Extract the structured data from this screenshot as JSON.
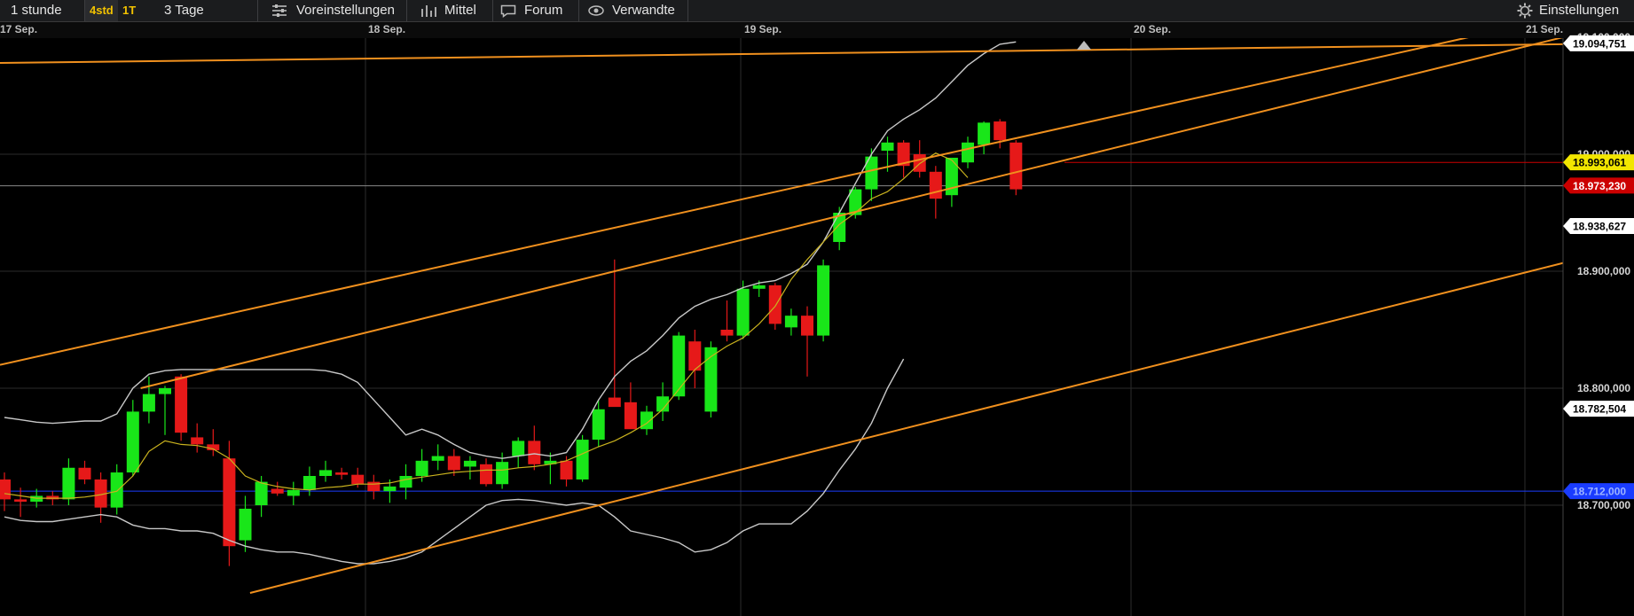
{
  "toolbar": {
    "interval_label": "1 stunde",
    "range_4std": "4std",
    "range_1t": "1T",
    "range_3tage": "3 Tage",
    "presets_label": "Voreinstellungen",
    "indicator_label": "Mittel",
    "forum_label": "Forum",
    "related_label": "Verwandte",
    "settings_label": "Einstellungen",
    "icons": {
      "presets": "sliders-icon",
      "indicator": "bar-chart-icon",
      "forum": "speech-bubble-icon",
      "related": "eye-icon",
      "settings": "gear-icon"
    }
  },
  "colors": {
    "up": "#19e619",
    "down": "#e61919",
    "channel": "#f0901e",
    "band": "#c8c8c8",
    "sma": "#c9b21e",
    "price_marker": "#cc0000",
    "ref_marker": "#f2e600",
    "blue_level": "#1a3cff",
    "background": "#000000"
  },
  "chart_data": {
    "type": "candlestick",
    "title": "",
    "xlabel": "",
    "ylabel": "",
    "ylim": [
      18.58,
      19.1
    ],
    "x_date_ticks": [
      "17 Sep.",
      "18 Sep.",
      "19 Sep.",
      "20 Sep.",
      "21 Sep."
    ],
    "y_tick_labels": [
      "19.100,000",
      "19.000,000",
      "18.900,000",
      "18.800,000",
      "18.700,000"
    ],
    "y_ticks": [
      19.1,
      19.0,
      18.9,
      18.8,
      18.7
    ],
    "series_candles": [
      [
        18.722,
        18.728,
        18.695,
        18.705
      ],
      [
        18.705,
        18.715,
        18.69,
        18.703
      ],
      [
        18.703,
        18.714,
        18.698,
        18.708
      ],
      [
        18.708,
        18.712,
        18.7,
        18.705
      ],
      [
        18.705,
        18.74,
        18.7,
        18.732
      ],
      [
        18.732,
        18.738,
        18.718,
        18.722
      ],
      [
        18.722,
        18.728,
        18.685,
        18.698
      ],
      [
        18.698,
        18.735,
        18.692,
        18.728
      ],
      [
        18.728,
        18.79,
        18.725,
        18.78
      ],
      [
        18.78,
        18.81,
        18.77,
        18.795
      ],
      [
        18.795,
        18.802,
        18.76,
        18.8
      ],
      [
        18.81,
        18.812,
        18.755,
        18.762
      ],
      [
        18.758,
        18.77,
        18.745,
        18.752
      ],
      [
        18.752,
        18.765,
        18.742,
        18.747
      ],
      [
        18.74,
        18.755,
        18.648,
        18.665
      ],
      [
        18.67,
        18.708,
        18.66,
        18.697
      ],
      [
        18.7,
        18.725,
        18.69,
        18.72
      ],
      [
        18.714,
        18.72,
        18.708,
        18.71
      ],
      [
        18.708,
        18.72,
        18.7,
        18.713
      ],
      [
        18.713,
        18.733,
        18.708,
        18.725
      ],
      [
        18.725,
        18.738,
        18.72,
        18.73
      ],
      [
        18.728,
        18.732,
        18.722,
        18.726
      ],
      [
        18.726,
        18.732,
        18.715,
        18.718
      ],
      [
        18.72,
        18.726,
        18.705,
        18.712
      ],
      [
        18.712,
        18.722,
        18.702,
        18.716
      ],
      [
        18.715,
        18.735,
        18.705,
        18.725
      ],
      [
        18.725,
        18.748,
        18.72,
        18.738
      ],
      [
        18.738,
        18.752,
        18.73,
        18.742
      ],
      [
        18.742,
        18.748,
        18.725,
        18.73
      ],
      [
        18.733,
        18.742,
        18.722,
        18.738
      ],
      [
        18.735,
        18.74,
        18.716,
        18.718
      ],
      [
        18.718,
        18.745,
        18.714,
        18.737
      ],
      [
        18.742,
        18.758,
        18.732,
        18.755
      ],
      [
        18.755,
        18.768,
        18.73,
        18.735
      ],
      [
        18.735,
        18.745,
        18.718,
        18.738
      ],
      [
        18.738,
        18.742,
        18.716,
        18.722
      ],
      [
        18.722,
        18.76,
        18.72,
        18.756
      ],
      [
        18.756,
        18.79,
        18.75,
        18.782
      ],
      [
        18.792,
        18.91,
        18.786,
        18.784
      ],
      [
        18.788,
        18.805,
        18.77,
        18.765
      ],
      [
        18.765,
        18.785,
        18.76,
        18.78
      ],
      [
        18.78,
        18.805,
        18.772,
        18.793
      ],
      [
        18.793,
        18.848,
        18.79,
        18.845
      ],
      [
        18.84,
        18.85,
        18.8,
        18.815
      ],
      [
        18.78,
        18.84,
        18.775,
        18.835
      ],
      [
        18.85,
        18.875,
        18.84,
        18.845
      ],
      [
        18.845,
        18.892,
        18.842,
        18.885
      ],
      [
        18.885,
        18.892,
        18.878,
        18.888
      ],
      [
        18.888,
        18.89,
        18.85,
        18.855
      ],
      [
        18.852,
        18.868,
        18.845,
        18.862
      ],
      [
        18.862,
        18.87,
        18.81,
        18.845
      ],
      [
        18.845,
        18.91,
        18.84,
        18.905
      ],
      [
        18.925,
        18.955,
        18.918,
        18.95
      ],
      [
        18.948,
        18.972,
        18.945,
        18.97
      ],
      [
        18.97,
        19.005,
        18.96,
        18.998
      ],
      [
        19.003,
        19.015,
        18.985,
        19.01
      ],
      [
        19.01,
        19.012,
        18.98,
        18.99
      ],
      [
        19.0,
        19.012,
        18.98,
        18.985
      ],
      [
        18.985,
        18.99,
        18.945,
        18.962
      ],
      [
        18.965,
        18.995,
        18.955,
        18.997
      ],
      [
        18.993,
        19.015,
        18.988,
        19.01
      ],
      [
        19.008,
        19.028,
        19.0,
        19.027
      ],
      [
        19.028,
        19.03,
        19.005,
        19.012
      ],
      [
        19.01,
        19.012,
        18.965,
        18.97
      ]
    ],
    "bollinger_upper": [
      18.775,
      18.773,
      18.771,
      18.77,
      18.771,
      18.772,
      18.772,
      18.778,
      18.8,
      18.812,
      18.815,
      18.816,
      18.816,
      18.816,
      18.816,
      18.816,
      18.816,
      18.816,
      18.816,
      18.816,
      18.815,
      18.812,
      18.805,
      18.79,
      18.775,
      18.76,
      18.765,
      18.76,
      18.752,
      18.745,
      18.742,
      18.74,
      18.742,
      18.744,
      18.742,
      18.745,
      18.765,
      18.79,
      18.81,
      18.823,
      18.832,
      18.845,
      18.86,
      18.87,
      18.876,
      18.88,
      18.886,
      18.89,
      18.892,
      18.898,
      18.906,
      18.925,
      18.95,
      18.975,
      19.0,
      19.02,
      19.03,
      19.038,
      19.048,
      19.062,
      19.076,
      19.086,
      19.094,
      19.096
    ],
    "bollinger_lower": [
      18.69,
      18.687,
      18.686,
      18.686,
      18.688,
      18.69,
      18.692,
      18.69,
      18.683,
      18.68,
      18.68,
      18.678,
      18.678,
      18.676,
      18.67,
      18.665,
      18.662,
      18.66,
      18.66,
      18.658,
      18.655,
      18.652,
      18.65,
      18.65,
      18.652,
      18.655,
      18.66,
      18.67,
      18.68,
      18.69,
      18.7,
      18.704,
      18.705,
      18.704,
      18.702,
      18.7,
      18.702,
      18.7,
      18.69,
      18.678,
      18.675,
      18.672,
      18.668,
      18.66,
      18.662,
      18.668,
      18.678,
      18.684,
      18.684,
      18.684,
      18.695,
      18.71,
      18.73,
      18.748,
      18.77,
      18.8,
      18.825
    ],
    "sma": [
      18.71,
      18.708,
      18.706,
      18.706,
      18.706,
      18.707,
      18.709,
      18.712,
      18.725,
      18.746,
      18.755,
      18.752,
      18.751,
      18.748,
      18.74,
      18.725,
      18.719,
      18.716,
      18.714,
      18.713,
      18.715,
      18.716,
      18.718,
      18.718,
      18.719,
      18.722,
      18.724,
      18.726,
      18.728,
      18.729,
      18.73,
      18.73,
      18.732,
      18.733,
      18.735,
      18.738,
      18.744,
      18.75,
      18.755,
      18.762,
      18.77,
      18.782,
      18.799,
      18.816,
      18.827,
      18.836,
      18.843,
      18.855,
      18.87,
      18.893,
      18.91,
      18.925,
      18.94,
      18.95,
      18.962,
      18.968,
      18.979,
      18.992,
      19.001,
      18.995,
      18.98
    ],
    "price_labels": [
      {
        "text": "19.094,751",
        "style": "white-tag"
      },
      {
        "text": "18.993,061",
        "style": "yellow-tag"
      },
      {
        "text": "18.973,230",
        "style": "red-tag"
      },
      {
        "text": "18.938,627",
        "style": "white-tag"
      },
      {
        "text": "18.782,504",
        "style": "white-tag"
      },
      {
        "text": "18.712,000",
        "style": "blue-tag"
      }
    ],
    "horizontal_levels": [
      {
        "value": 18.993,
        "color": "#cc0000"
      },
      {
        "value": 18.973,
        "color": "#888888"
      },
      {
        "value": 18.712,
        "color": "#1a3cff"
      }
    ],
    "trend_lines": [
      {
        "from": [
          0,
          19.078
        ],
        "to": [
          1,
          19.094
        ]
      },
      {
        "from": [
          0,
          18.82
        ],
        "to": [
          1,
          19.118
        ]
      },
      {
        "from": [
          0.09,
          18.8
        ],
        "to": [
          1,
          19.1
        ]
      },
      {
        "from": [
          0.16,
          18.625
        ],
        "to": [
          1,
          18.907
        ]
      }
    ]
  }
}
